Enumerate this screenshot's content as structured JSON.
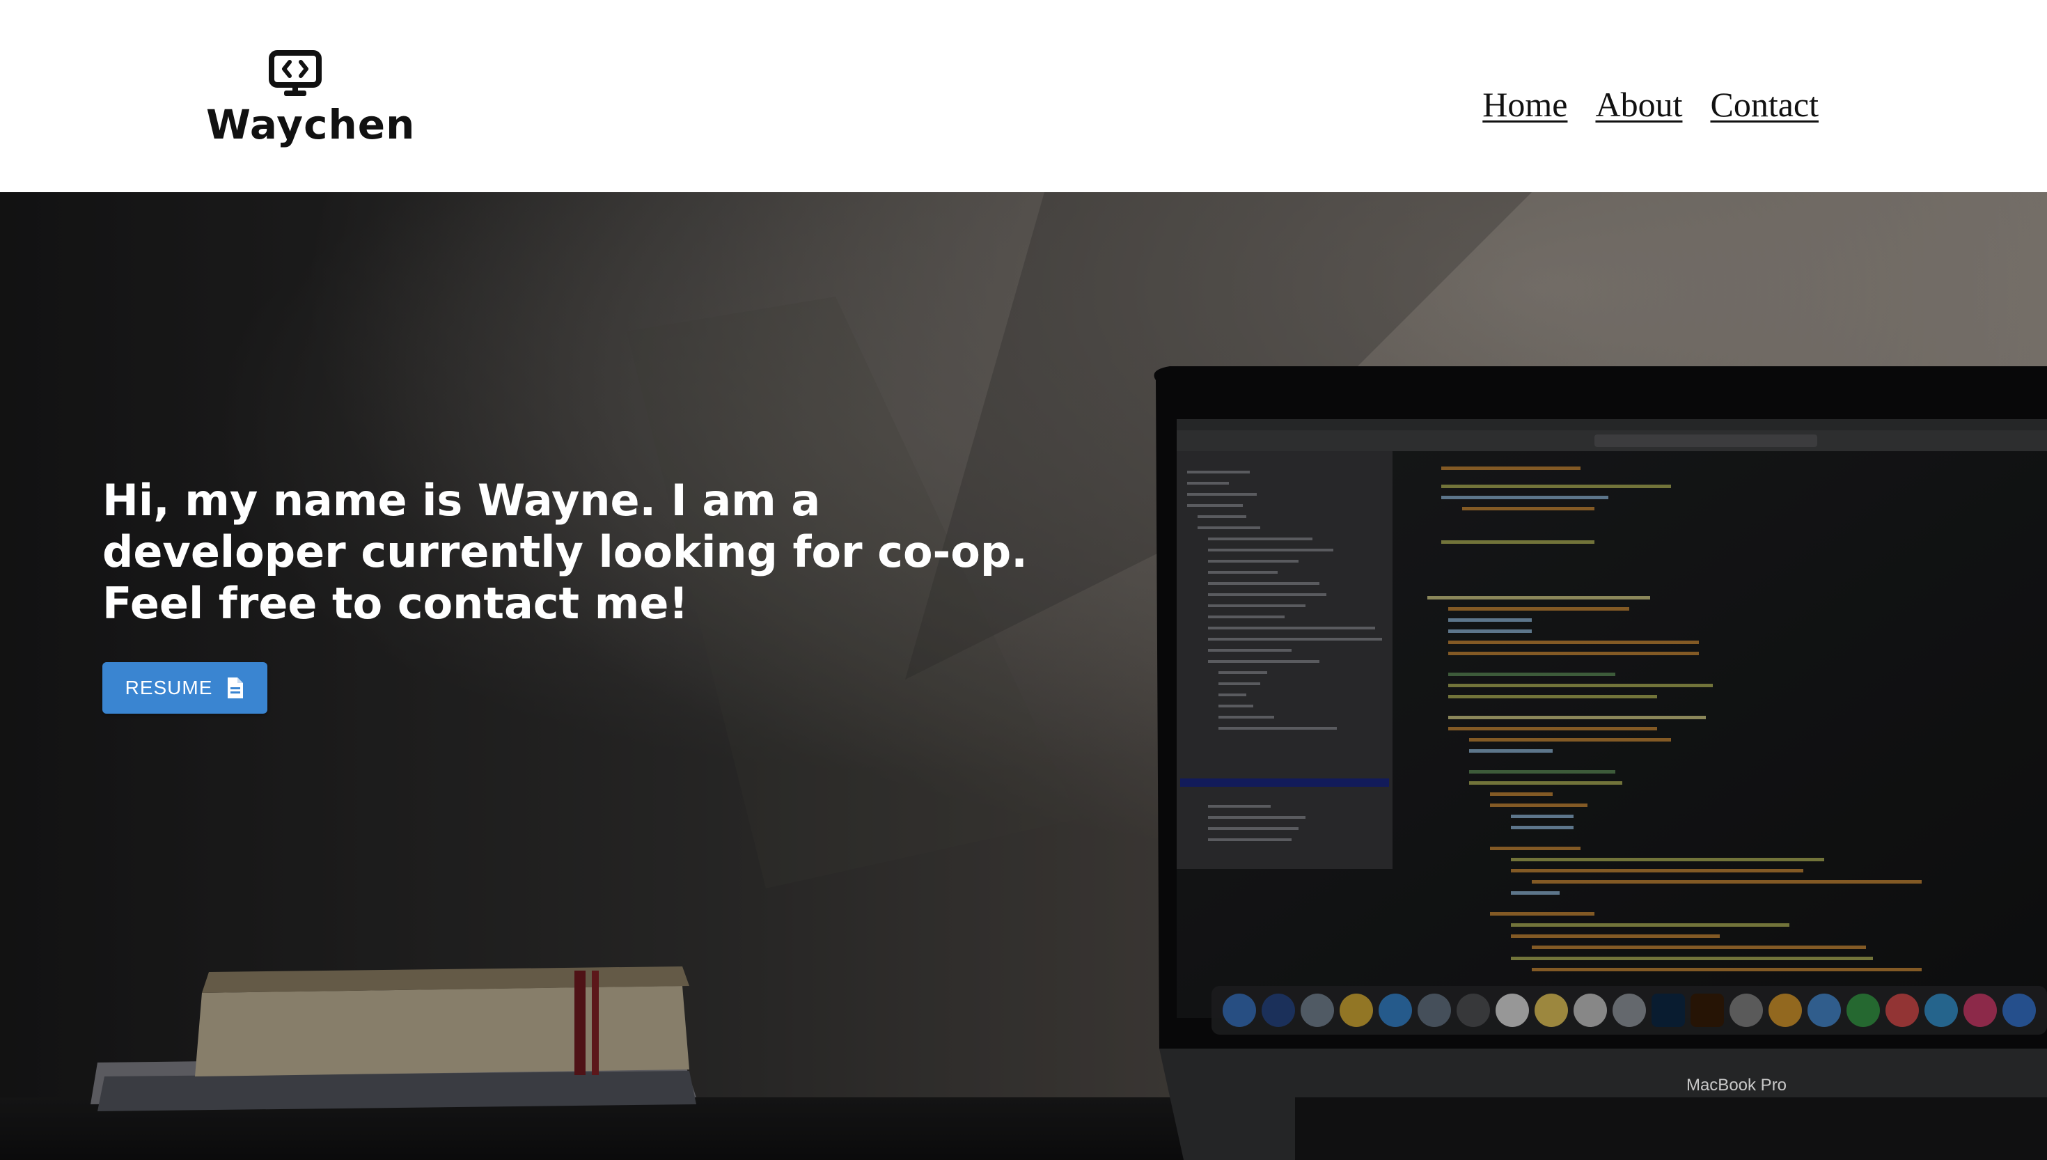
{
  "header": {
    "logo_text": "Waychen",
    "logo_icon": "monitor-code-icon",
    "nav": [
      {
        "label": "Home"
      },
      {
        "label": "About"
      },
      {
        "label": "Contact"
      }
    ]
  },
  "hero": {
    "headline": "Hi, my name is Wayne. I am a developer currently looking for co-op. Feel free to contact me!",
    "resume_button": {
      "label": "RESUME",
      "icon": "document-icon",
      "color": "#3a85d1"
    },
    "laptop_label": "MacBook Pro"
  }
}
